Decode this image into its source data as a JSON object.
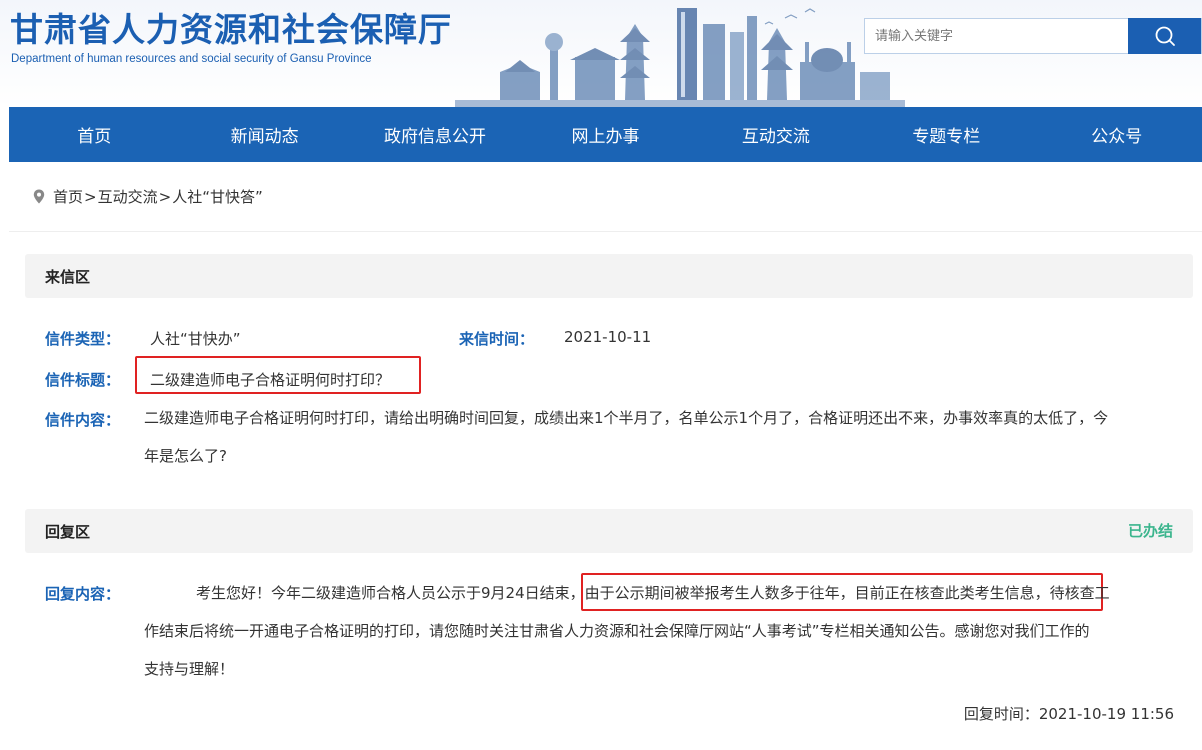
{
  "header": {
    "title": "甘肃省人力资源和社会保障厅",
    "subtitle": "Department of human resources and social security of Gansu Province",
    "search_placeholder": "请输入关键字",
    "search_icon": "search-icon"
  },
  "nav": {
    "items": [
      "首页",
      "新闻动态",
      "政府信息公开",
      "网上办事",
      "互动交流",
      "专题专栏",
      "公众号"
    ]
  },
  "breadcrumb": {
    "icon": "location-pin-icon",
    "items": [
      "首页",
      "互动交流",
      "人社“甘快答”"
    ],
    "separator": ">"
  },
  "letter": {
    "section_title": "来信区",
    "type_label": "信件类型：",
    "type_value": "人社“甘快办”",
    "time_label": "来信时间：",
    "time_value": "2021-10-11",
    "title_label": "信件标题：",
    "title_value": "二级建造师电子合格证明何时打印？",
    "content_label": "信件内容：",
    "content_line1": "二级建造师电子合格证明何时打印，请给出明确时间回复，成绩出来1个半月了，名单公示1个月了，合格证明还出不来，办事效率真的太低了，今",
    "content_line2": "年是怎么了?"
  },
  "reply": {
    "section_title": "回复区",
    "status": "已办结",
    "content_label": "回复内容：",
    "line1_a": "考生您好！今年二级建造师合格人员公示于9月24日结束",
    "line1_b": "，由于公示期间被举报考生人数多于往年，目前正在核查此类考生信息",
    "line1_c": "，待核查工",
    "line2": "作结束后将统一开通电子合格证明的打印，请您随时关注甘肃省人力资源和社会保障厅网站“人事考试”专栏相关通知公告。感谢您对我们工作的",
    "line3": "支持与理解！",
    "time": "回复时间：2021-10-19 11:56"
  },
  "colors": {
    "brand_blue": "#1b64b5",
    "status_green": "#3bb58d",
    "highlight_red": "#e02222"
  }
}
